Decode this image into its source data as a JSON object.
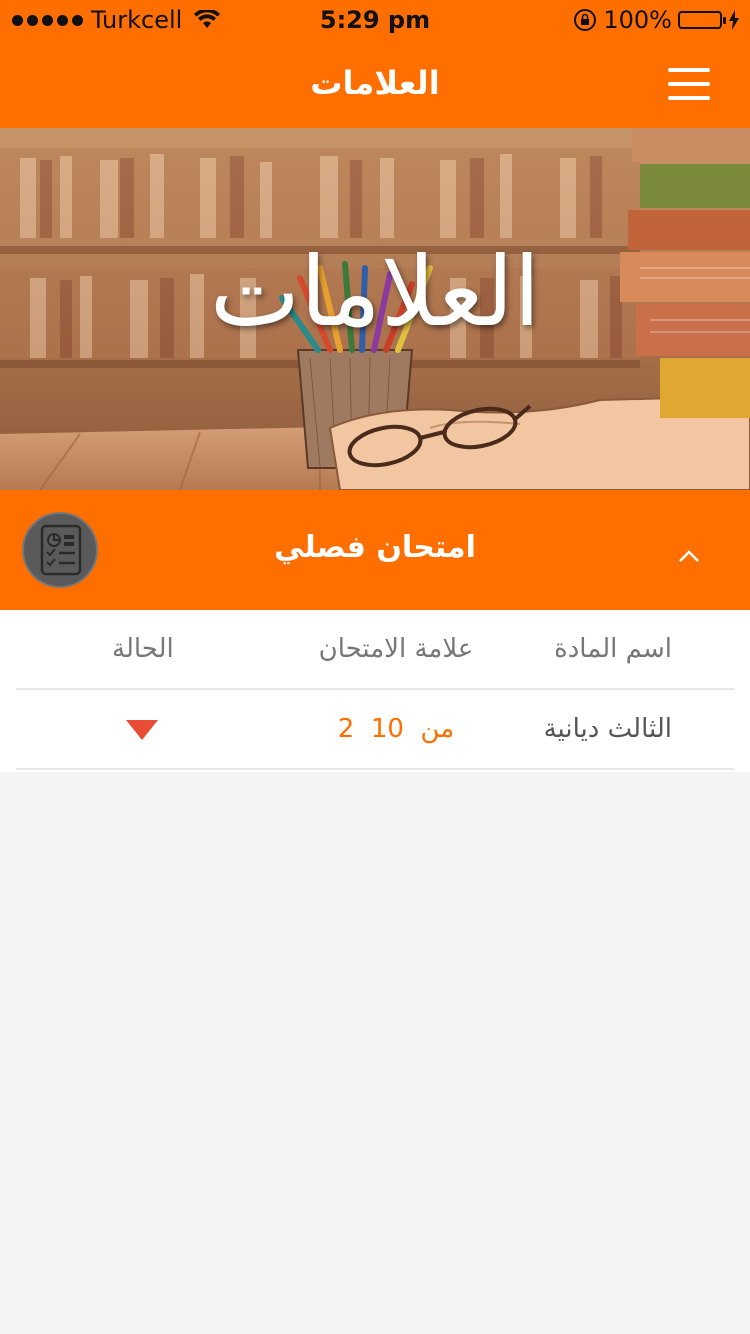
{
  "status_bar": {
    "carrier": "Turkcell",
    "time": "5:29 pm",
    "battery": "100%"
  },
  "navbar": {
    "title": "العلامات",
    "menu_icon": "hamburger-menu-icon"
  },
  "hero": {
    "title": "العلامات"
  },
  "section": {
    "title": "امتحان فصلي",
    "icon": "report-card-icon",
    "toggle_icon": "chevron-up-icon"
  },
  "table": {
    "headers": {
      "subject": "اسم المادة",
      "grade": "علامة الامتحان",
      "status": "الحالة"
    },
    "rows": [
      {
        "subject": "الثالث ديانية",
        "grade": "2  من  10",
        "status_icon": "triangle-down-icon",
        "status_color": "#e94d35"
      }
    ]
  },
  "colors": {
    "accent": "#ff6f00",
    "background": "#f4f4f4"
  }
}
